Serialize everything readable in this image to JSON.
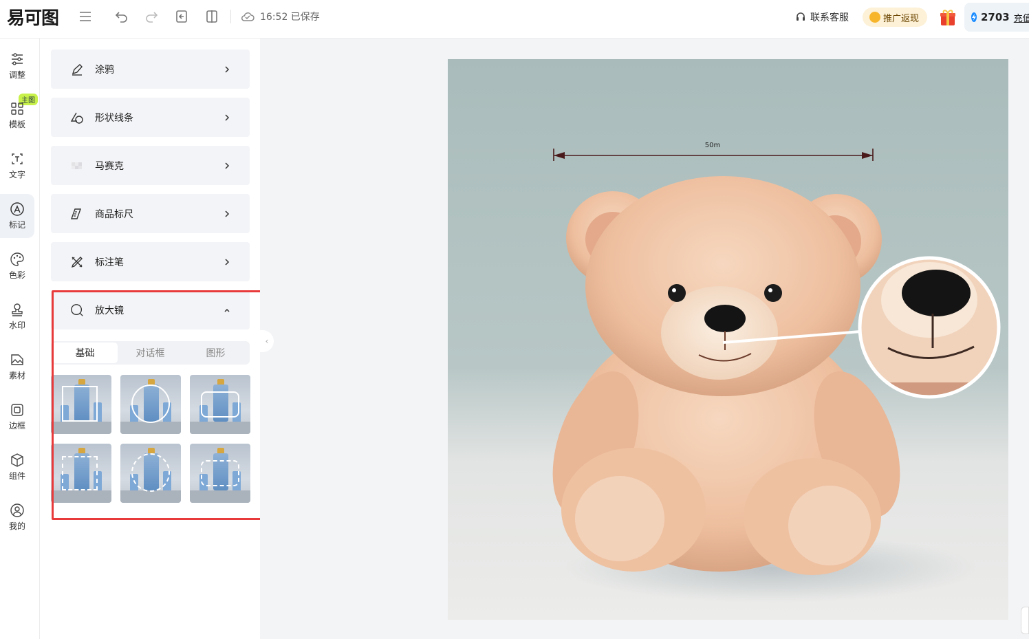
{
  "app": {
    "logo_text": "易可图"
  },
  "topbar": {
    "save_time": "16:52 已保存",
    "contact_label": "联系客服",
    "promo_label": "推广返现",
    "credits": "2703",
    "recharge_label": "充值"
  },
  "leftnav": {
    "badge": "主图",
    "items": [
      {
        "label": "调整",
        "icon": "sliders-icon"
      },
      {
        "label": "模板",
        "icon": "grid-icon"
      },
      {
        "label": "文字",
        "icon": "text-icon"
      },
      {
        "label": "标记",
        "icon": "mark-icon",
        "active": true
      },
      {
        "label": "色彩",
        "icon": "palette-icon"
      },
      {
        "label": "水印",
        "icon": "stamp-icon"
      },
      {
        "label": "素材",
        "icon": "material-icon"
      },
      {
        "label": "边框",
        "icon": "frame-icon"
      },
      {
        "label": "组件",
        "icon": "cube-icon"
      },
      {
        "label": "我的",
        "icon": "user-icon"
      }
    ]
  },
  "panel": {
    "tools": [
      {
        "label": "涂鸦",
        "icon": "brush-icon"
      },
      {
        "label": "形状线条",
        "icon": "shapes-icon"
      },
      {
        "label": "马赛克",
        "icon": "mosaic-icon"
      },
      {
        "label": "商品标尺",
        "icon": "ruler-icon"
      },
      {
        "label": "标注笔",
        "icon": "pen-icon"
      },
      {
        "label": "放大镜",
        "icon": "magnifier-icon",
        "expanded": true
      }
    ],
    "tabs": [
      "基础",
      "对话框",
      "图形"
    ],
    "active_tab": "基础"
  },
  "canvas": {
    "ruler_label": "50m"
  }
}
